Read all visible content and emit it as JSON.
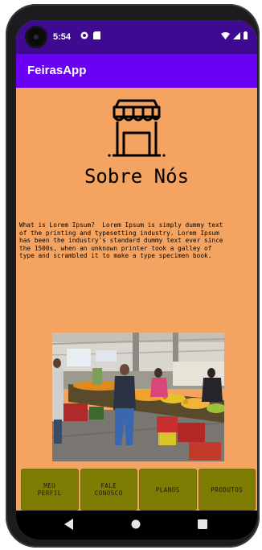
{
  "status_bar": {
    "time": "5:54",
    "left_icons": [
      "app-notification-icon",
      "sd-card-icon"
    ],
    "right_icons": [
      "wifi-icon",
      "signal-icon",
      "battery-icon"
    ]
  },
  "app_bar": {
    "title": "FeirasApp"
  },
  "main": {
    "logo_icon": "market-stall-icon",
    "title": "Sobre Nós",
    "description": "What is Lorem Ipsum?  Lorem Ipsum is simply dummy text\nof the printing and typesetting industry. Lorem Ipsum\nhas been the industry's standard dummy text ever since\nthe 1500s, when an unknown printer took a galley of\ntype and scrambled it to make a type specimen book.",
    "photo": "market-photo"
  },
  "nav_buttons": [
    {
      "label": "MEU\nPERFIL"
    },
    {
      "label": "FALE\nCONOSCO"
    },
    {
      "label": "PLANOS"
    },
    {
      "label": "PRODUTOS"
    }
  ],
  "system_nav": [
    "back-icon",
    "home-icon",
    "recents-icon"
  ],
  "colors": {
    "status_bar": "#3d0a91",
    "app_bar": "#6a00f4",
    "background": "#f4a460",
    "nav_button": "#7e7c02"
  }
}
